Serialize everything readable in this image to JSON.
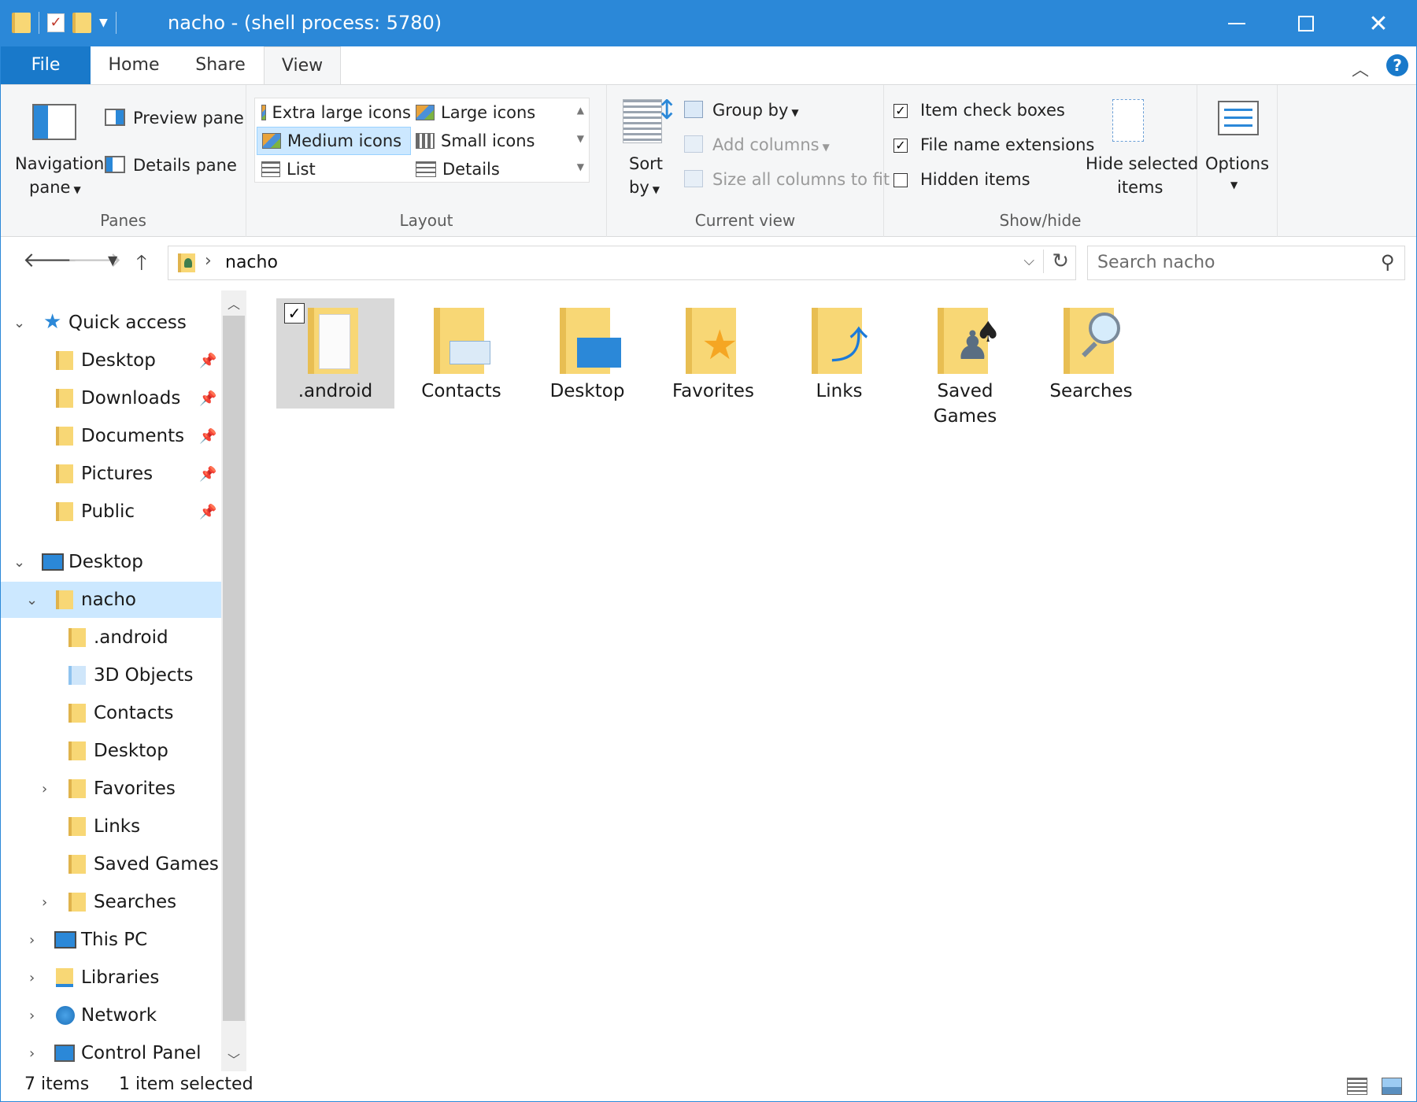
{
  "window": {
    "title": "nacho - (shell process: 5780)",
    "accent": "#2b88d8"
  },
  "tabs": [
    {
      "label": "File"
    },
    {
      "label": "Home"
    },
    {
      "label": "Share"
    },
    {
      "label": "View"
    }
  ],
  "help_label": "?",
  "ribbon": {
    "panes": {
      "label": "Panes",
      "navigation_pane_line1": "Navigation",
      "navigation_pane_line2": "pane",
      "preview_pane": "Preview pane",
      "details_pane": "Details pane"
    },
    "layout": {
      "label": "Layout",
      "options": [
        {
          "label": "Extra large icons"
        },
        {
          "label": "Large icons"
        },
        {
          "label": "Medium icons",
          "selected": true
        },
        {
          "label": "Small icons"
        },
        {
          "label": "List"
        },
        {
          "label": "Details"
        }
      ]
    },
    "current_view": {
      "label": "Current view",
      "sort_by_line1": "Sort",
      "sort_by_line2": "by",
      "group_by": "Group by",
      "add_columns": "Add columns",
      "size_all_columns": "Size all columns to fit"
    },
    "show_hide": {
      "label": "Show/hide",
      "item_check_boxes": {
        "label": "Item check boxes",
        "checked": true
      },
      "file_name_extensions": {
        "label": "File name extensions",
        "checked": true
      },
      "hidden_items": {
        "label": "Hidden items",
        "checked": false
      },
      "hide_selected_line1": "Hide selected",
      "hide_selected_line2": "items"
    },
    "options": {
      "label": "Options"
    }
  },
  "address": {
    "path": "nacho",
    "search_placeholder": "Search nacho"
  },
  "tree": {
    "quick_access": "Quick access",
    "quick_items": [
      {
        "label": "Desktop"
      },
      {
        "label": "Downloads"
      },
      {
        "label": "Documents"
      },
      {
        "label": "Pictures"
      },
      {
        "label": "Public"
      }
    ],
    "desktop": "Desktop",
    "nacho": "nacho",
    "nacho_children": [
      {
        "label": ".android"
      },
      {
        "label": "3D Objects"
      },
      {
        "label": "Contacts"
      },
      {
        "label": "Desktop"
      },
      {
        "label": "Favorites"
      },
      {
        "label": "Links"
      },
      {
        "label": "Saved Games"
      },
      {
        "label": "Searches"
      }
    ],
    "roots": [
      {
        "label": "This PC"
      },
      {
        "label": "Libraries"
      },
      {
        "label": "Network"
      },
      {
        "label": "Control Panel"
      }
    ]
  },
  "content": {
    "items": [
      {
        "label": ".android",
        "selected": true,
        "icon": "folder-document-icon"
      },
      {
        "label": "Contacts",
        "icon": "contacts-folder-icon"
      },
      {
        "label": "Desktop",
        "icon": "desktop-folder-icon"
      },
      {
        "label": "Favorites",
        "icon": "favorites-folder-icon"
      },
      {
        "label": "Links",
        "icon": "links-folder-icon"
      },
      {
        "label": "Saved Games",
        "label_line1": "Saved",
        "label_line2": "Games",
        "icon": "saved-games-folder-icon"
      },
      {
        "label": "Searches",
        "icon": "searches-folder-icon"
      }
    ]
  },
  "status": {
    "item_count": "7 items",
    "selection": "1 item selected"
  }
}
